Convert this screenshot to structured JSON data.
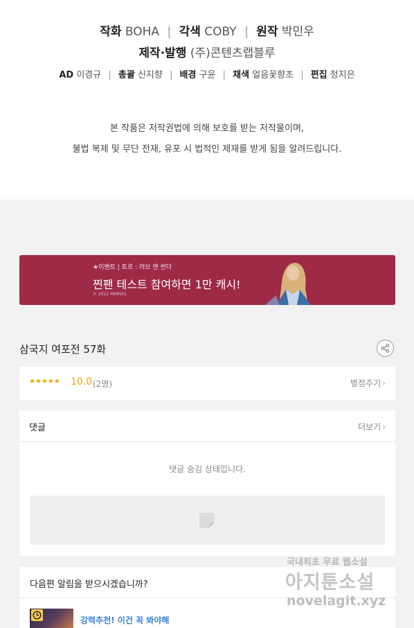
{
  "credits": {
    "line1": [
      {
        "role": "작화",
        "name": "BOHA"
      },
      {
        "role": "각색",
        "name": "COBY"
      },
      {
        "role": "원작",
        "name": "박민우"
      }
    ],
    "line2": {
      "role": "제작·발행",
      "name": "(주)콘텐츠랩블루"
    },
    "line3": [
      {
        "role": "AD",
        "name": "이경규"
      },
      {
        "role": "총괄",
        "name": "신지향"
      },
      {
        "role": "배경",
        "name": "구윤"
      },
      {
        "role": "채색",
        "name": "얼음꽃향초"
      },
      {
        "role": "편집",
        "name": "정지은"
      }
    ],
    "separator": "|"
  },
  "copyright": {
    "line1": "본 작품은 저작권법에 의해 보호를 받는 저작물이며,",
    "line2": "불법 복제 및 무단 전재, 유포 시 법적인 제재를 받게 됨을 알려드립니다."
  },
  "banner": {
    "tag": "★이벤트 | 토르 : 러브 앤 썬더",
    "title": "찐팬 테스트 참여하면 1만 캐시!",
    "copyright": "© 2022 MARVEL",
    "bg_color": "#9e2a45"
  },
  "episode": {
    "title": "삼국지 여포전 57화",
    "share_icon": "share-icon"
  },
  "rating": {
    "stars": "★★★★★",
    "score": "10.0",
    "count": "(2명)",
    "rate_label": "별점주기",
    "chevron": "›",
    "accent_color": "#f0a500"
  },
  "comments": {
    "title": "댓글",
    "more_label": "더보기",
    "chevron": "›",
    "hidden_message": "댓글 숨김 상태입니다."
  },
  "notify": {
    "question": "다음편 알림을 받으시겠습니까?",
    "recommend_label": "강력추천! 이건 꼭 봐야해",
    "link_color": "#3a82d6"
  },
  "watermark": {
    "line1": "국내최초 무료 웹소설",
    "line2": "아지툰소설",
    "line3": "novelagit.xyz"
  }
}
